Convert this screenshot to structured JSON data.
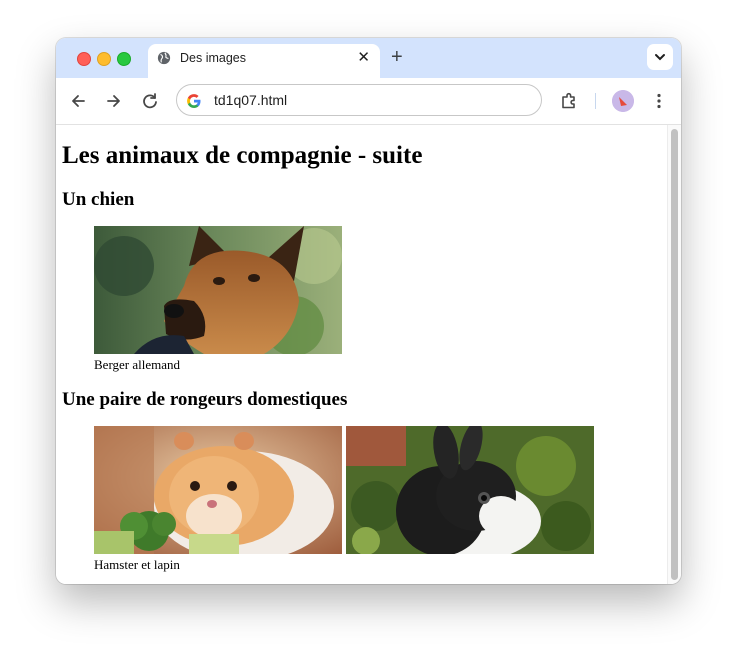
{
  "browser": {
    "tab": {
      "title": "Des images"
    },
    "address_bar": {
      "url": "td1q07.html"
    },
    "new_tab_label": "+"
  },
  "page": {
    "title": "Les animaux de compagnie - suite",
    "section1": {
      "heading": "Un chien",
      "caption": "Berger allemand"
    },
    "section2": {
      "heading": "Une paire de rongeurs domestiques",
      "caption": "Hamster et lapin"
    }
  },
  "icons": [
    "globe-icon",
    "close-icon",
    "plus-icon",
    "chevron-down-icon",
    "back-arrow-icon",
    "forward-arrow-icon",
    "reload-icon",
    "google-logo-icon",
    "extensions-icon",
    "profile-avatar-icon",
    "more-menu-icon"
  ]
}
